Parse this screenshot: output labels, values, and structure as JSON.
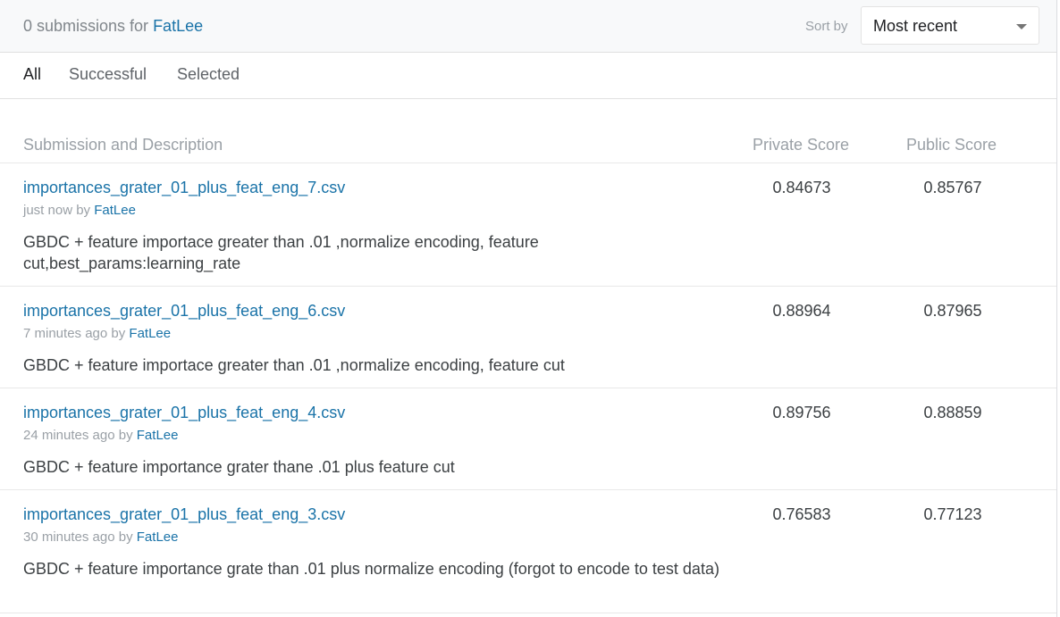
{
  "header": {
    "count_text": "0 submissions for",
    "user": "FatLee",
    "sort_label": "Sort by",
    "sort_value": "Most recent"
  },
  "tabs": [
    "All",
    "Successful",
    "Selected"
  ],
  "columns": {
    "description": "Submission and Description",
    "private": "Private Score",
    "public": "Public Score"
  },
  "submissions": [
    {
      "file": "importances_grater_01_plus_feat_eng_7.csv",
      "time": "just now",
      "by": "by",
      "user": "FatLee",
      "description": "GBDC + feature importace greater than .01 ,normalize encoding, feature cut,best_params:learning_rate",
      "private_score": "0.84673",
      "public_score": "0.85767"
    },
    {
      "file": "importances_grater_01_plus_feat_eng_6.csv",
      "time": "7 minutes ago",
      "by": "by",
      "user": "FatLee",
      "description": "GBDC + feature importace greater than .01 ,normalize encoding, feature cut",
      "private_score": "0.88964",
      "public_score": "0.87965"
    },
    {
      "file": "importances_grater_01_plus_feat_eng_4.csv",
      "time": "24 minutes ago",
      "by": "by",
      "user": "FatLee",
      "description": "GBDC + feature importance grater thane .01 plus feature cut",
      "private_score": "0.89756",
      "public_score": "0.88859"
    },
    {
      "file": "importances_grater_01_plus_feat_eng_3.csv",
      "time": "30 minutes ago",
      "by": "by",
      "user": "FatLee",
      "description": "GBDC + feature importance grate than .01 plus normalize encoding (forgot to encode to test data)",
      "private_score": "0.76583",
      "public_score": "0.77123"
    }
  ]
}
